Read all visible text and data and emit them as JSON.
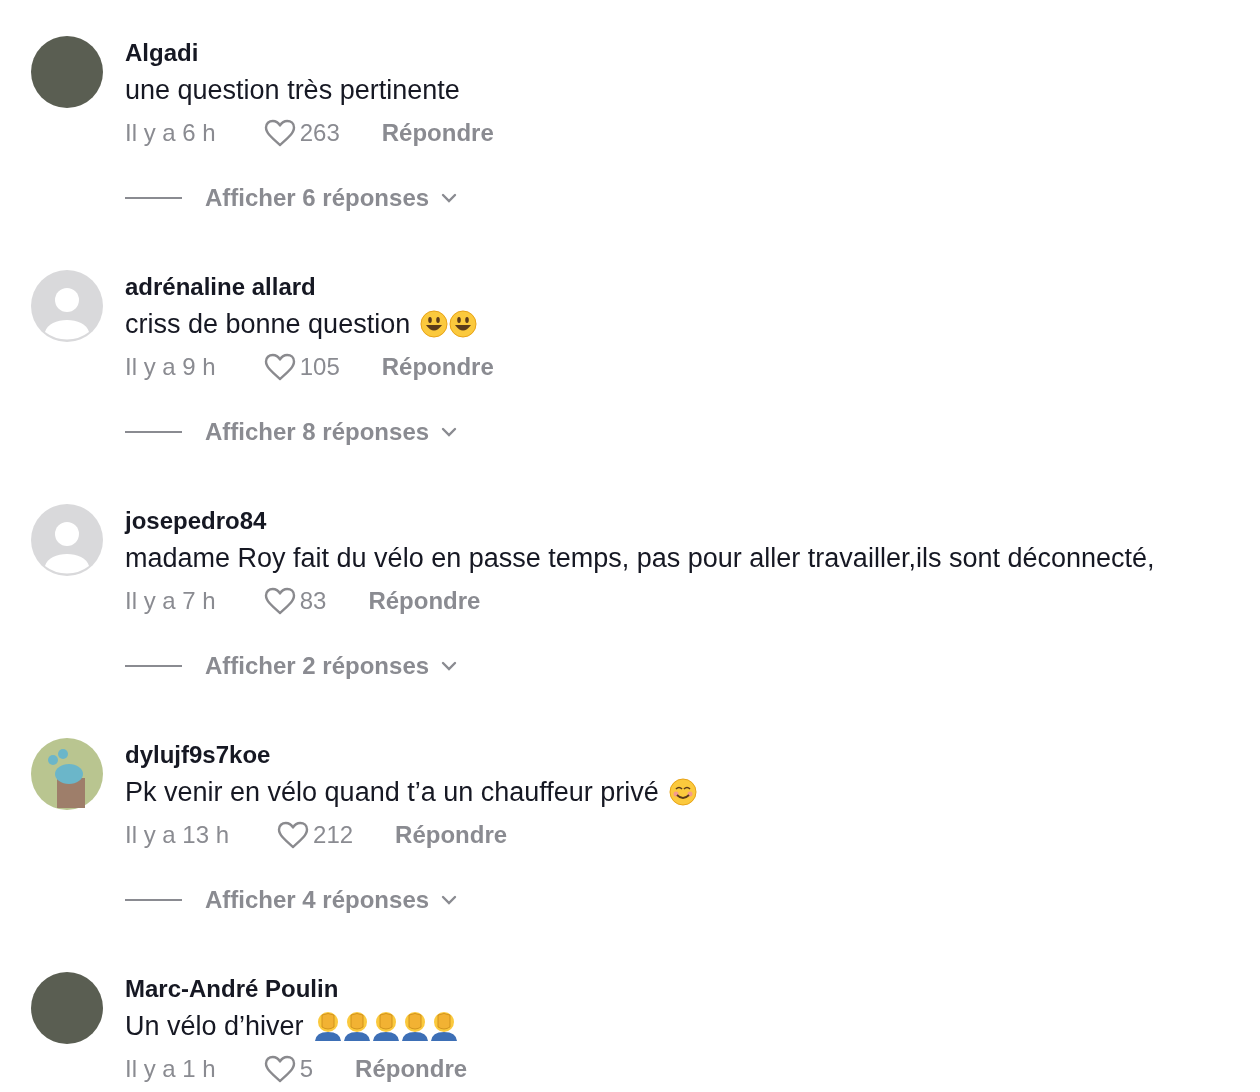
{
  "comments": [
    {
      "avatar": {
        "kind": "photo"
      },
      "username": "Algadi",
      "text": "une question très pertinente",
      "time": "Il y a 6 h",
      "likes": "263",
      "reply": "Répondre",
      "replies": "Afficher 6 réponses"
    },
    {
      "avatar": {
        "kind": "default"
      },
      "username": "adrénaline allard",
      "text": "criss de bonne question",
      "emojis": [
        {
          "kind": "grin"
        },
        {
          "kind": "grin"
        }
      ],
      "time": "Il y a 9 h",
      "likes": "105",
      "reply": "Répondre",
      "replies": "Afficher 8 réponses"
    },
    {
      "avatar": {
        "kind": "default"
      },
      "username": "josepedro84",
      "text": "madame Roy fait du vélo en passe temps, pas pour aller travailler,ils sont déconnecté,",
      "time": "Il y a 7 h",
      "likes": "83",
      "reply": "Répondre",
      "replies": "Afficher 2 réponses"
    },
    {
      "avatar": {
        "kind": "illustration"
      },
      "username": "dylujf9s7koe",
      "text": "Pk venir en vélo quand t’a un chauffeur privé",
      "emojis": [
        {
          "kind": "smile"
        }
      ],
      "time": "Il y a 13 h",
      "likes": "212",
      "reply": "Répondre",
      "replies": "Afficher 4 réponses"
    },
    {
      "avatar": {
        "kind": "photo"
      },
      "username": "Marc-André Poulin",
      "text": "Un vélo d’hiver",
      "emojis": [
        {
          "kind": "facepalm"
        },
        {
          "kind": "facepalm"
        },
        {
          "kind": "facepalm"
        },
        {
          "kind": "facepalm"
        },
        {
          "kind": "facepalm"
        }
      ],
      "time": "Il y a 1 h",
      "likes": "5",
      "reply": "Répondre"
    }
  ]
}
